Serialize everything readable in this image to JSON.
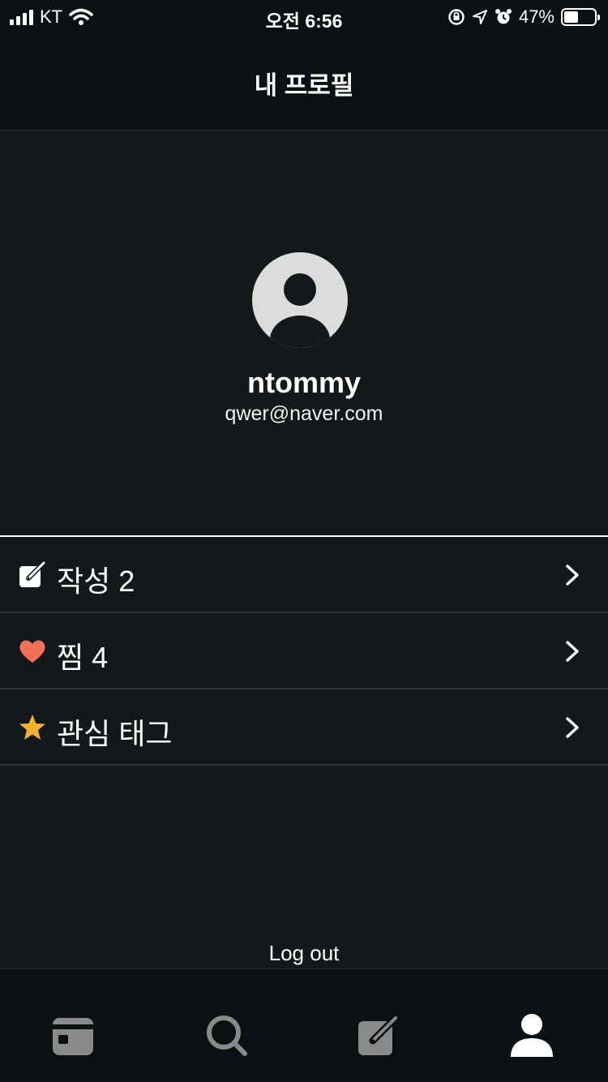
{
  "status_bar": {
    "carrier": "KT",
    "time": "오전 6:56",
    "battery": "47%",
    "battery_level": 0.47
  },
  "header": {
    "title": "내 프로필"
  },
  "profile": {
    "name": "ntommy",
    "email": "qwer@naver.com",
    "avatar_icon": "person-circle-icon"
  },
  "menu": {
    "items": [
      {
        "icon": "edit-icon",
        "label": "작성 2"
      },
      {
        "icon": "heart-icon",
        "label": "찜 4",
        "icon_color": "#f07058"
      },
      {
        "icon": "star-icon",
        "label": "관심 태그",
        "icon_color": "#f5b030"
      }
    ]
  },
  "logout": {
    "label": "Log out"
  },
  "tab_bar": {
    "tabs": [
      {
        "icon": "calendar-icon",
        "active": false
      },
      {
        "icon": "search-icon",
        "active": false
      },
      {
        "icon": "compose-icon",
        "active": false
      },
      {
        "icon": "profile-icon",
        "active": true
      }
    ]
  },
  "colors": {
    "background": "#13181a",
    "bar": "#0b1012",
    "inactive_icon": "#8a8a8a"
  }
}
